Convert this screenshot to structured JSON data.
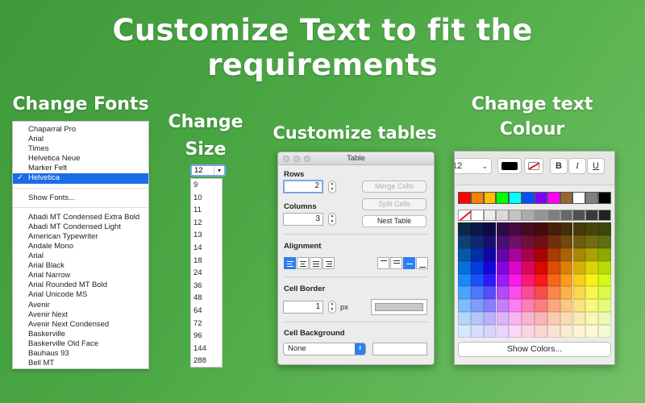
{
  "headline": "Customize Text to fit the requirements",
  "sections": {
    "fonts": "Change Fonts",
    "size": "Change Size",
    "tables": "Customize tables",
    "colour": "Change text Colour"
  },
  "fonts_menu": {
    "top_items": [
      "Chaparral Pro",
      "Arial",
      "Times",
      "Helvetica Neue",
      "Marker Felt"
    ],
    "selected": "Helvetica",
    "checkmark": "✓",
    "show_fonts": "Show Fonts...",
    "all_fonts": [
      "Abadi MT Condensed Extra Bold",
      "Abadi MT Condensed Light",
      "American Typewriter",
      "Andale Mono",
      "Arial",
      "Arial Black",
      "Arial Narrow",
      "Arial Rounded MT Bold",
      "Arial Unicode MS",
      "Avenir",
      "Avenir Next",
      "Avenir Next Condensed",
      "Baskerville",
      "Baskerville Old Face",
      "Bauhaus 93",
      "Bell MT"
    ]
  },
  "size_list": {
    "current": "12",
    "sizes": [
      "9",
      "10",
      "11",
      "12",
      "13",
      "14",
      "18",
      "24",
      "36",
      "48",
      "64",
      "72",
      "96",
      "144",
      "288"
    ]
  },
  "table_panel": {
    "title": "Table",
    "rows_label": "Rows",
    "rows_value": "2",
    "columns_label": "Columns",
    "columns_value": "3",
    "merge_cells": "Merge Cells",
    "split_cells": "Split Cells",
    "nest_table": "Nest Table",
    "alignment_label": "Alignment",
    "cell_border_label": "Cell Border",
    "border_value": "1",
    "border_unit": "px",
    "cell_background_label": "Cell Background",
    "background_value": "None"
  },
  "color_panel": {
    "font_size": "12",
    "bold": "B",
    "italic": "I",
    "underline": "U",
    "show_colors": "Show Colors...",
    "top_colors": [
      "#ff0000",
      "#ff8000",
      "#ffc000",
      "#00ff00",
      "#00ffff",
      "#0050ff",
      "#8000ff",
      "#ff00ff",
      "#996633",
      "#ffffff",
      "#808080",
      "#000000"
    ],
    "grays": [
      "#ffffff",
      "#ececec",
      "#d9d9d9",
      "#c3c3c3",
      "#acacac",
      "#959595",
      "#7e7e7e",
      "#676767",
      "#505050",
      "#393939",
      "#222222"
    ]
  }
}
